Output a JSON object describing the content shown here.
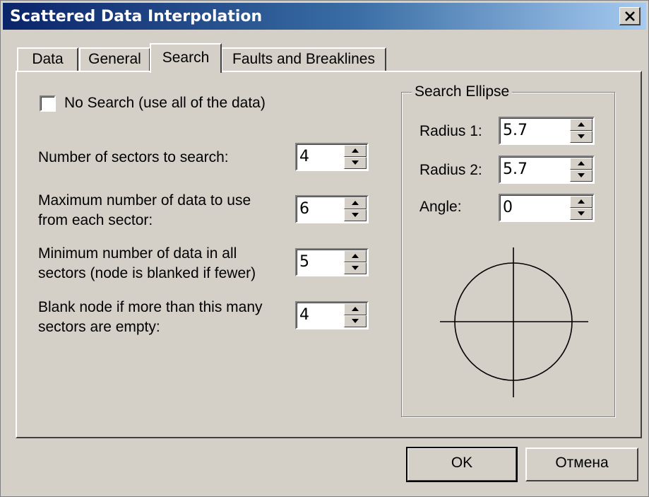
{
  "window": {
    "title": "Scattered Data Interpolation"
  },
  "tabs": [
    {
      "label": "Data"
    },
    {
      "label": "General"
    },
    {
      "label": "Search"
    },
    {
      "label": "Faults and Breaklines"
    }
  ],
  "search": {
    "no_search_label": "No Search (use all of the data)",
    "no_search_checked": false,
    "sectors_label": "Number of sectors to search:",
    "sectors_value": "4",
    "max_data_label_1": "Maximum number of data to use",
    "max_data_label_2": "from each sector:",
    "max_data_value": "6",
    "min_data_label_1": "Minimum number of data in all",
    "min_data_label_2": "sectors (node is blanked if fewer)",
    "min_data_value": "5",
    "blank_label_1": "Blank node if more than this many",
    "blank_label_2": "sectors are empty:",
    "blank_value": "4"
  },
  "ellipse": {
    "group_title": "Search Ellipse",
    "radius1_label": "Radius 1:",
    "radius1_value": "5.7",
    "radius2_label": "Radius 2:",
    "radius2_value": "5.7",
    "angle_label": "Angle:",
    "angle_value": "0"
  },
  "buttons": {
    "ok": "OK",
    "cancel": "Отмена"
  }
}
